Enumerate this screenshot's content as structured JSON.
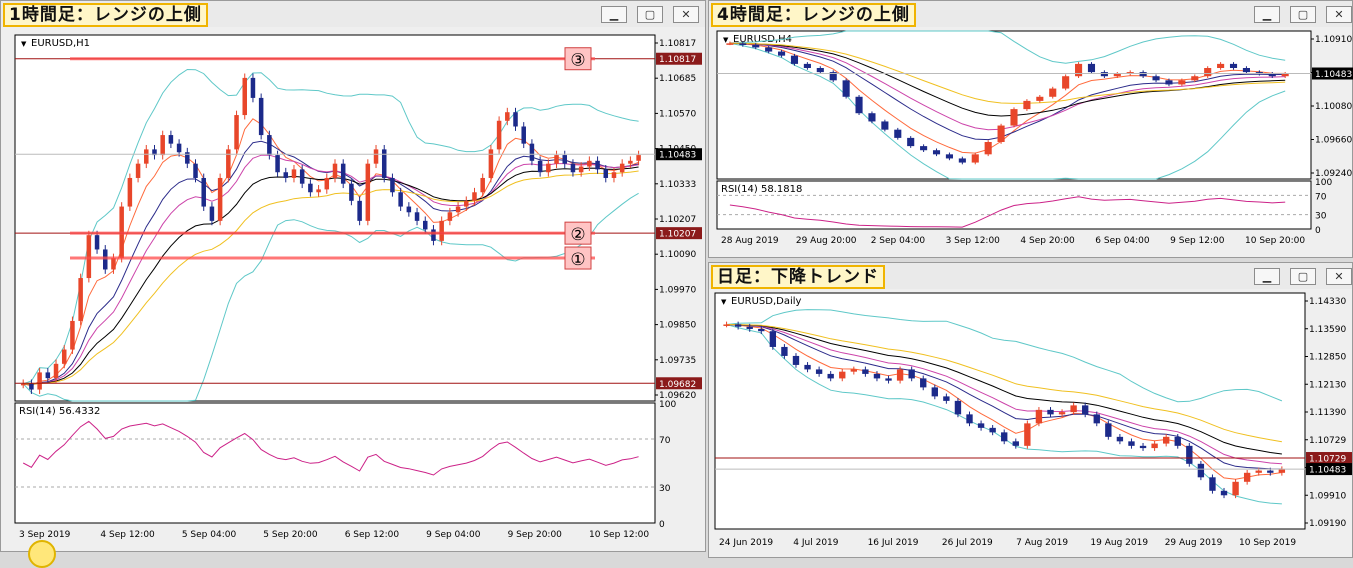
{
  "windows": [
    {
      "caption": "1時間足：レンジの上側",
      "symbol": "EURUSD,H1",
      "rsi_label": "RSI(14) 56.4332",
      "price_ticks": [
        "1.10817",
        "1.10685",
        "1.10570",
        "1.10450",
        "1.10333",
        "1.10207",
        "1.10090",
        "1.09970",
        "1.09850",
        "1.09735",
        "1.09620"
      ],
      "highlight_labels": [
        {
          "text": "1.10817",
          "value": 1.10817,
          "color": "#8b1a1a"
        },
        {
          "text": "1.10483",
          "value": 1.10483,
          "color": "#000000"
        },
        {
          "text": "1.10207",
          "value": 1.10207,
          "color": "#8b1a1a"
        },
        {
          "text": "1.09682",
          "value": 1.09682,
          "color": "#8b1a1a"
        }
      ],
      "rsi_ticks": [
        "100",
        "70",
        "30",
        "0"
      ],
      "time_ticks": [
        "3 Sep 2019",
        "4 Sep 12:00",
        "5 Sep 04:00",
        "5 Sep 20:00",
        "6 Sep 12:00",
        "9 Sep 04:00",
        "9 Sep 20:00",
        "10 Sep 12:00"
      ],
      "markers": [
        {
          "label": "③",
          "value": 1.10817
        },
        {
          "label": "②",
          "value": 1.10207
        },
        {
          "label": "①",
          "value": 1.1012
        }
      ]
    },
    {
      "caption": "4時間足：レンジの上側",
      "symbol": "EURUSD,H4",
      "rsi_label": "RSI(14) 58.1818",
      "price_ticks": [
        "1.10910",
        "1.10483",
        "1.10080",
        "1.09660",
        "1.09240"
      ],
      "highlight_labels": [
        {
          "text": "1.10483",
          "value": 1.10483,
          "color": "#000000"
        }
      ],
      "rsi_ticks": [
        "100",
        "70",
        "30",
        "0"
      ],
      "time_ticks": [
        "28 Aug 2019",
        "29 Aug 20:00",
        "2 Sep 04:00",
        "3 Sep 12:00",
        "4 Sep 20:00",
        "6 Sep 04:00",
        "9 Sep 12:00",
        "10 Sep 20:00"
      ]
    },
    {
      "caption": "日足：下降トレンド",
      "symbol": "EURUSD,Daily",
      "price_ticks": [
        "1.14330",
        "1.13590",
        "1.12850",
        "1.12130",
        "1.11390",
        "1.10729",
        "1.10483",
        "1.09910",
        "1.09190"
      ],
      "highlight_labels": [
        {
          "text": "1.10729",
          "value": 1.10729,
          "color": "#8b1a1a"
        },
        {
          "text": "1.10483",
          "value": 1.10483,
          "color": "#000000"
        }
      ],
      "time_ticks": [
        "24 Jun 2019",
        "4 Jul 2019",
        "16 Jul 2019",
        "26 Jul 2019",
        "7 Aug 2019",
        "19 Aug 2019",
        "29 Aug 2019",
        "10 Sep 2019"
      ]
    }
  ],
  "chart_data": [
    {
      "type": "line",
      "title": "EURUSD,H1",
      "ylim": [
        1.0962,
        1.109
      ],
      "series": [],
      "candles": [
        1.0968,
        1.0966,
        1.0972,
        1.097,
        1.0975,
        1.098,
        1.099,
        1.1005,
        1.102,
        1.1015,
        1.1008,
        1.1012,
        1.103,
        1.104,
        1.1045,
        1.105,
        1.1048,
        1.1055,
        1.1052,
        1.1049,
        1.1045,
        1.104,
        1.103,
        1.1025,
        1.104,
        1.105,
        1.1062,
        1.1075,
        1.1068,
        1.1055,
        1.1048,
        1.1042,
        1.104,
        1.1043,
        1.1038,
        1.1035,
        1.1036,
        1.104,
        1.1045,
        1.1038,
        1.1032,
        1.1025,
        1.1045,
        1.105,
        1.104,
        1.1035,
        1.103,
        1.1028,
        1.1025,
        1.1022,
        1.1018,
        1.1025,
        1.1028,
        1.103,
        1.1032,
        1.1035,
        1.104,
        1.105,
        1.106,
        1.1063,
        1.1058,
        1.1052,
        1.1046,
        1.1042,
        1.1045,
        1.1048,
        1.1045,
        1.1042,
        1.1044,
        1.1046,
        1.1043,
        1.104,
        1.1042,
        1.1045,
        1.1046,
        1.1048
      ]
    },
    {
      "type": "line",
      "title": "EURUSD,H4",
      "ylim": [
        1.092,
        1.11
      ],
      "series": [],
      "candles": [
        1.1085,
        1.1083,
        1.108,
        1.1075,
        1.107,
        1.106,
        1.1055,
        1.105,
        1.104,
        1.102,
        1.1,
        1.099,
        1.098,
        1.097,
        1.096,
        1.0955,
        1.095,
        1.0945,
        1.094,
        1.095,
        1.0965,
        1.0985,
        1.1005,
        1.1015,
        1.102,
        1.103,
        1.1045,
        1.106,
        1.105,
        1.1045,
        1.1048,
        1.105,
        1.1045,
        1.104,
        1.1035,
        1.104,
        1.1045,
        1.1055,
        1.106,
        1.1055,
        1.105,
        1.1048,
        1.1045,
        1.1048
      ]
    },
    {
      "type": "line",
      "title": "EURUSD,Daily",
      "ylim": [
        1.0915,
        1.144
      ],
      "series": [],
      "candles": [
        1.137,
        1.1365,
        1.136,
        1.1355,
        1.132,
        1.13,
        1.128,
        1.127,
        1.126,
        1.125,
        1.1265,
        1.127,
        1.126,
        1.125,
        1.1245,
        1.127,
        1.125,
        1.123,
        1.121,
        1.12,
        1.117,
        1.115,
        1.114,
        1.113,
        1.111,
        1.11,
        1.115,
        1.118,
        1.117,
        1.1175,
        1.119,
        1.117,
        1.115,
        1.112,
        1.111,
        1.11,
        1.1095,
        1.1105,
        1.112,
        1.11,
        1.106,
        1.103,
        1.1,
        1.099,
        1.102,
        1.104,
        1.1045,
        1.104,
        1.1048
      ]
    }
  ]
}
